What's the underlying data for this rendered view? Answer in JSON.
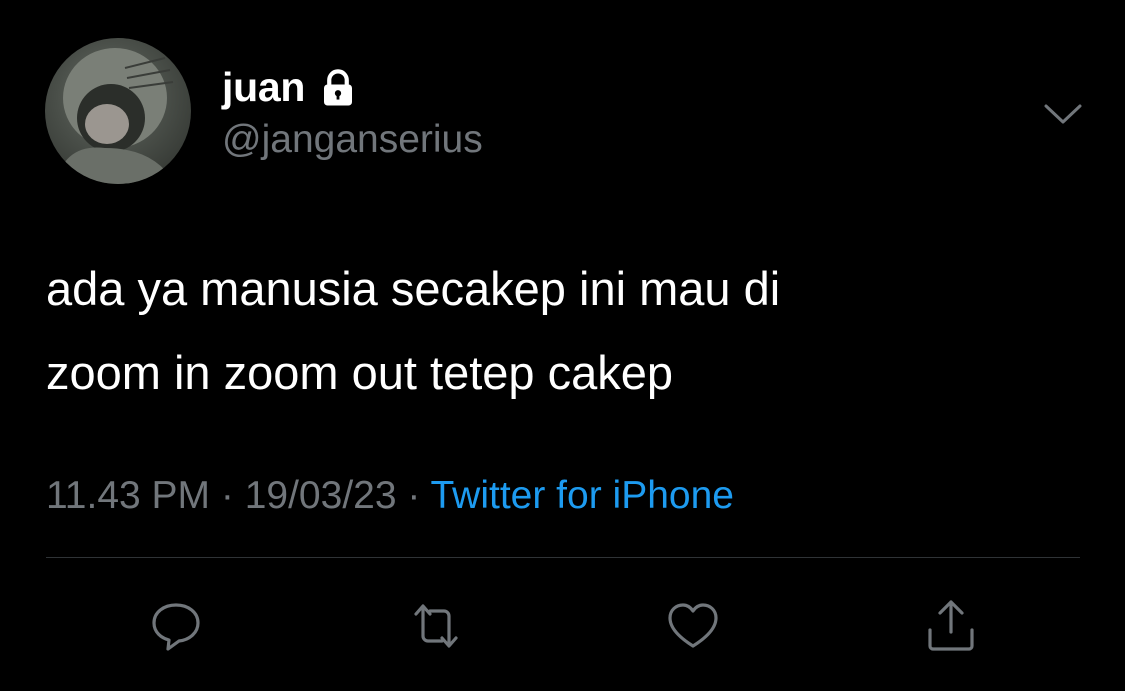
{
  "tweet": {
    "author": {
      "display_name": "juan",
      "handle": "@janganserius",
      "protected_icon": "lock-icon",
      "avatar_icon": "profile-photo"
    },
    "more_icon": "chevron-down-icon",
    "text_lines": [
      "ada ya manusia secakep ini mau di",
      "zoom in zoom out tetep cakep"
    ],
    "meta": {
      "time": "11.43 PM",
      "separator": " · ",
      "date": "19/03/23",
      "source": "Twitter for iPhone"
    },
    "actions": [
      {
        "name": "reply",
        "icon": "reply-icon"
      },
      {
        "name": "retweet",
        "icon": "retweet-icon"
      },
      {
        "name": "like",
        "icon": "heart-icon"
      },
      {
        "name": "share",
        "icon": "share-icon"
      }
    ]
  },
  "colors": {
    "background": "#000000",
    "primary_text": "#ffffff",
    "secondary_text": "#71767b",
    "link": "#1d9bf0",
    "divider": "#2f3336"
  }
}
